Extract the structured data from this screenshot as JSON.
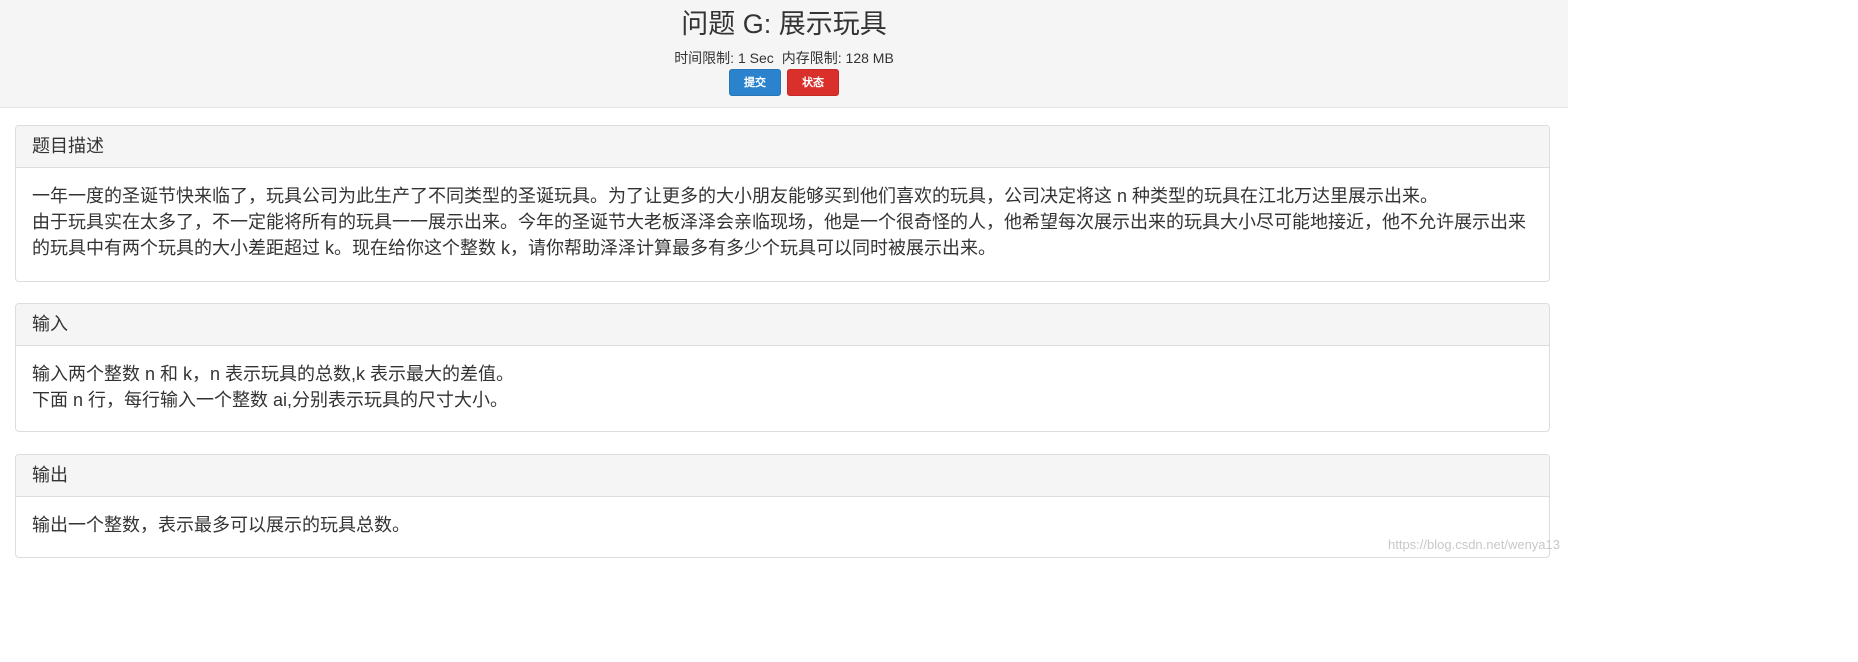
{
  "header": {
    "title": "问题 G: 展示玩具",
    "time_limit": "时间限制: 1 Sec",
    "memory_limit": "内存限制: 128 MB",
    "submit_label": "提交",
    "status_label": "状态"
  },
  "sections": {
    "description": {
      "heading": "题目描述",
      "lines": [
        "一年一度的圣诞节快来临了，玩具公司为此生产了不同类型的圣诞玩具。为了让更多的大小朋友能够买到他们喜欢的玩具，公司决定将这 n 种类型的玩具在江北万达里展示出来。",
        "由于玩具实在太多了，不一定能将所有的玩具一一展示出来。今年的圣诞节大老板泽泽会亲临现场，他是一个很奇怪的人，他希望每次展示出来的玩具大小尽可能地接近，他不允许展示出来的玩具中有两个玩具的大小差距超过 k。现在给你这个整数 k，请你帮助泽泽计算最多有多少个玩具可以同时被展示出来。"
      ]
    },
    "input": {
      "heading": "输入",
      "lines": [
        "输入两个整数 n 和 k，n 表示玩具的总数,k 表示最大的差值。",
        "下面 n 行，每行输入一个整数 ai,分别表示玩具的尺寸大小。"
      ]
    },
    "output": {
      "heading": "输出",
      "lines": [
        "输出一个整数，表示最多可以展示的玩具总数。"
      ]
    }
  },
  "watermark": "https://blog.csdn.net/wenya13",
  "colors": {
    "submit": "#2a83cc",
    "status": "#d9302c",
    "panel_heading_bg": "#f5f5f5",
    "border": "#dddddd"
  }
}
